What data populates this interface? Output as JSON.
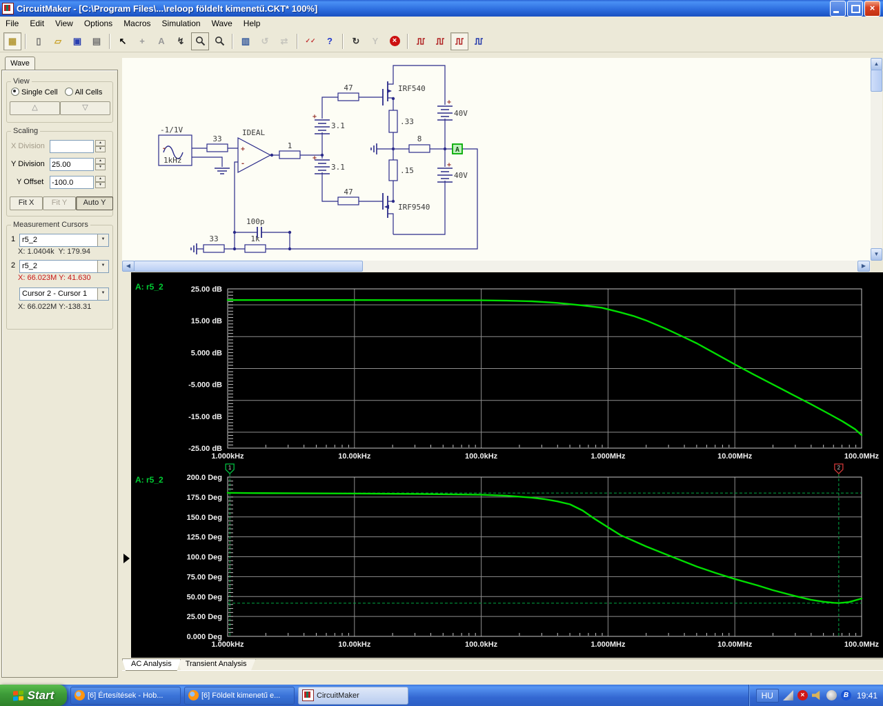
{
  "window": {
    "title": "CircuitMaker - [C:\\Program Files\\...\\reloop földelt kimenetű.CKT* 100%]"
  },
  "menu": [
    "File",
    "Edit",
    "View",
    "Options",
    "Macros",
    "Simulation",
    "Wave",
    "Help"
  ],
  "toolbar": [
    {
      "name": "part-browser-button",
      "icon": "grid",
      "pressed": true
    },
    {
      "name": "separator"
    },
    {
      "name": "new-button",
      "icon": "page"
    },
    {
      "name": "open-button",
      "icon": "folder"
    },
    {
      "name": "save-button",
      "icon": "floppy"
    },
    {
      "name": "print-button",
      "icon": "printer"
    },
    {
      "name": "separator"
    },
    {
      "name": "cursor-tool-button",
      "icon": "arrow"
    },
    {
      "name": "wire-tool-button",
      "icon": "plus"
    },
    {
      "name": "text-tool-button",
      "icon": "text"
    },
    {
      "name": "delete-tool-button",
      "icon": "bolt"
    },
    {
      "name": "zoom-tool-button",
      "icon": "mag",
      "framed": true
    },
    {
      "name": "zoom-in-button",
      "icon": "mag"
    },
    {
      "name": "separator"
    },
    {
      "name": "zoom-page-button",
      "icon": "pagemag"
    },
    {
      "name": "rotate-button",
      "icon": "rotate",
      "disabled": true
    },
    {
      "name": "mirror-button",
      "icon": "mirror",
      "disabled": true
    },
    {
      "name": "separator"
    },
    {
      "name": "sim-setup-button",
      "icon": "checks"
    },
    {
      "name": "help-button",
      "icon": "help"
    },
    {
      "name": "separator"
    },
    {
      "name": "reset-button",
      "icon": "reset"
    },
    {
      "name": "probe-button",
      "icon": "wye",
      "disabled": true
    },
    {
      "name": "stop-button",
      "icon": "stop"
    },
    {
      "name": "separator"
    },
    {
      "name": "scope-step-button",
      "icon": "wave"
    },
    {
      "name": "scope-square-button",
      "icon": "wave"
    },
    {
      "name": "scope-pulse-button",
      "icon": "wave",
      "pressed": true
    },
    {
      "name": "scope-mixed-button",
      "icon": "wave2"
    }
  ],
  "sidebar": {
    "tab_label": "Wave",
    "view": {
      "title": "View",
      "option1": "Single Cell",
      "option2": "All Cells",
      "up_glyph": "△",
      "down_glyph": "▽"
    },
    "scaling": {
      "title": "Scaling",
      "x_division_label": "X Division",
      "x_division_value": "",
      "y_division_label": "Y Division",
      "y_division_value": "25.00",
      "y_offset_label": "Y Offset",
      "y_offset_value": "-100.0",
      "fit_x": "Fit X",
      "fit_y": "Fit Y",
      "auto_y": "Auto Y"
    },
    "cursors": {
      "title": "Measurement Cursors",
      "cursor1_index": "1",
      "cursor1_signal": "r5_2",
      "cursor1_readout": "X: 1.0404k  Y: 179.94",
      "cursor2_index": "2",
      "cursor2_signal": "r5_2",
      "cursor2_readout": "X: 66.023M Y: 41.630",
      "diff_selector": "Cursor 2 - Cursor 1",
      "diff_readout": "X: 66.022M Y:-138.31"
    }
  },
  "schematic": {
    "src_amp": "-1/1V",
    "src_freq": "1kHz",
    "r_in": "33",
    "opamp": "IDEAL",
    "r_series": "1",
    "bat_drv_top": "3.1",
    "bat_drv_bot": "3.1",
    "r_gate_top": "47",
    "r_gate_bot": "47",
    "fet_top": "IRF540",
    "fet_bot": "IRF9540",
    "r_src_top": ".33",
    "r_src_bot": ".15",
    "r_out": "8",
    "bat_rail_top": "40V",
    "bat_rail_bot": "40V",
    "probe": "A",
    "fb_cap": "100p",
    "fb_res": "1k",
    "fb_gnd_res": "33",
    "plus_sign": "+",
    "minus_sign": "-"
  },
  "chart_data": [
    {
      "type": "line",
      "trace_label": "A: r5_2",
      "x_scale": "log",
      "xlim_log10": [
        3,
        8
      ],
      "ylim": [
        -25,
        25
      ],
      "x_ticks": [
        "1.000kHz",
        "10.00kHz",
        "100.0kHz",
        "1.000MHz",
        "10.00MHz",
        "100.0MHz"
      ],
      "y_ticks": [
        "25.00 dB",
        "15.00 dB",
        "5.000 dB",
        "-5.000 dB",
        "-15.00 dB",
        "-25.00 dB"
      ],
      "y_tick_values": [
        25,
        15,
        5,
        -5,
        -15,
        -25
      ],
      "grid_y_values": [
        20,
        10,
        0,
        -10,
        -20
      ],
      "minor_y_step": 1,
      "series": [
        {
          "name": "r5_2",
          "color": "#00dd00",
          "points_log10f_y": [
            [
              3,
              21.5
            ],
            [
              4,
              21.5
            ],
            [
              4.7,
              21.45
            ],
            [
              5,
              21.4
            ],
            [
              5.2,
              21.3
            ],
            [
              5.4,
              21.1
            ],
            [
              5.6,
              20.6
            ],
            [
              5.8,
              19.8
            ],
            [
              5.95,
              19.1
            ],
            [
              6.1,
              17.6
            ],
            [
              6.2,
              16.5
            ],
            [
              6.3,
              15.1
            ],
            [
              6.45,
              12.6
            ],
            [
              6.6,
              9.8
            ],
            [
              6.7,
              7.9
            ],
            [
              6.85,
              4.6
            ],
            [
              7.0,
              1.3
            ],
            [
              7.15,
              -1.9
            ],
            [
              7.3,
              -5.0
            ],
            [
              7.45,
              -8.1
            ],
            [
              7.6,
              -11.2
            ],
            [
              7.75,
              -14.4
            ],
            [
              7.85,
              -16.6
            ],
            [
              7.95,
              -19.1
            ],
            [
              8.0,
              -20.9
            ]
          ]
        }
      ],
      "cursors": []
    },
    {
      "type": "line",
      "trace_label": "A: r5_2",
      "x_scale": "log",
      "xlim_log10": [
        3,
        8
      ],
      "ylim": [
        0,
        200
      ],
      "x_ticks": [
        "1.000kHz",
        "10.00kHz",
        "100.0kHz",
        "1.000MHz",
        "10.00MHz",
        "100.0MHz"
      ],
      "y_ticks": [
        "200.0 Deg",
        "175.0 Deg",
        "150.0 Deg",
        "125.0 Deg",
        "100.0 Deg",
        "75.00 Deg",
        "50.00 Deg",
        "25.00 Deg",
        "0.000 Deg"
      ],
      "y_tick_values": [
        200,
        175,
        150,
        125,
        100,
        75,
        50,
        25,
        0
      ],
      "grid_y_values": [
        175,
        150,
        125,
        100,
        75,
        50,
        25
      ],
      "minor_y_step": 5,
      "series": [
        {
          "name": "r5_2",
          "color": "#00dd00",
          "points_log10f_y": [
            [
              3,
              180.3
            ],
            [
              3.2,
              179.9
            ],
            [
              3.5,
              179.7
            ],
            [
              4,
              179.4
            ],
            [
              4.5,
              178.9
            ],
            [
              5,
              177.8
            ],
            [
              5.2,
              176.6
            ],
            [
              5.4,
              174.2
            ],
            [
              5.5,
              172.3
            ],
            [
              5.6,
              169.5
            ],
            [
              5.7,
              165.8
            ],
            [
              5.8,
              158.0
            ],
            [
              5.9,
              147.0
            ],
            [
              6.0,
              137.0
            ],
            [
              6.1,
              127.0
            ],
            [
              6.2,
              120.0
            ],
            [
              6.3,
              113.0
            ],
            [
              6.48,
              101.5
            ],
            [
              6.7,
              87.6
            ],
            [
              6.85,
              79.6
            ],
            [
              7.0,
              72.0
            ],
            [
              7.18,
              64.0
            ],
            [
              7.3,
              58.0
            ],
            [
              7.48,
              50.5
            ],
            [
              7.6,
              46.0
            ],
            [
              7.7,
              43.5
            ],
            [
              7.78,
              42.2
            ],
            [
              7.82,
              41.8
            ],
            [
              7.9,
              43.0
            ],
            [
              8.0,
              47.5
            ]
          ]
        }
      ],
      "cursors": [
        {
          "n": "1",
          "log10x": 3.0172,
          "x_label": "1.0404k",
          "y": 179.94,
          "flag_color": "#00c040"
        },
        {
          "n": "2",
          "log10x": 7.8197,
          "x_label": "66.023M",
          "y": 41.63,
          "flag_color": "#d03838"
        }
      ]
    }
  ],
  "tabs": [
    {
      "label": "AC Analysis",
      "active": true
    },
    {
      "label": "Transient Analysis",
      "active": false
    }
  ],
  "taskbar": {
    "start_label": "Start",
    "tasks": [
      {
        "label": "[6] Értesítések - Hob...",
        "icon": "firefox-icon",
        "active": false
      },
      {
        "label": "[6] Földelt kimenetű e...",
        "icon": "firefox-icon",
        "active": false
      },
      {
        "label": "CircuitMaker",
        "icon": "circuitmaker-icon",
        "active": true
      }
    ],
    "tray_language": "HU",
    "tray_clock": "19:41"
  }
}
